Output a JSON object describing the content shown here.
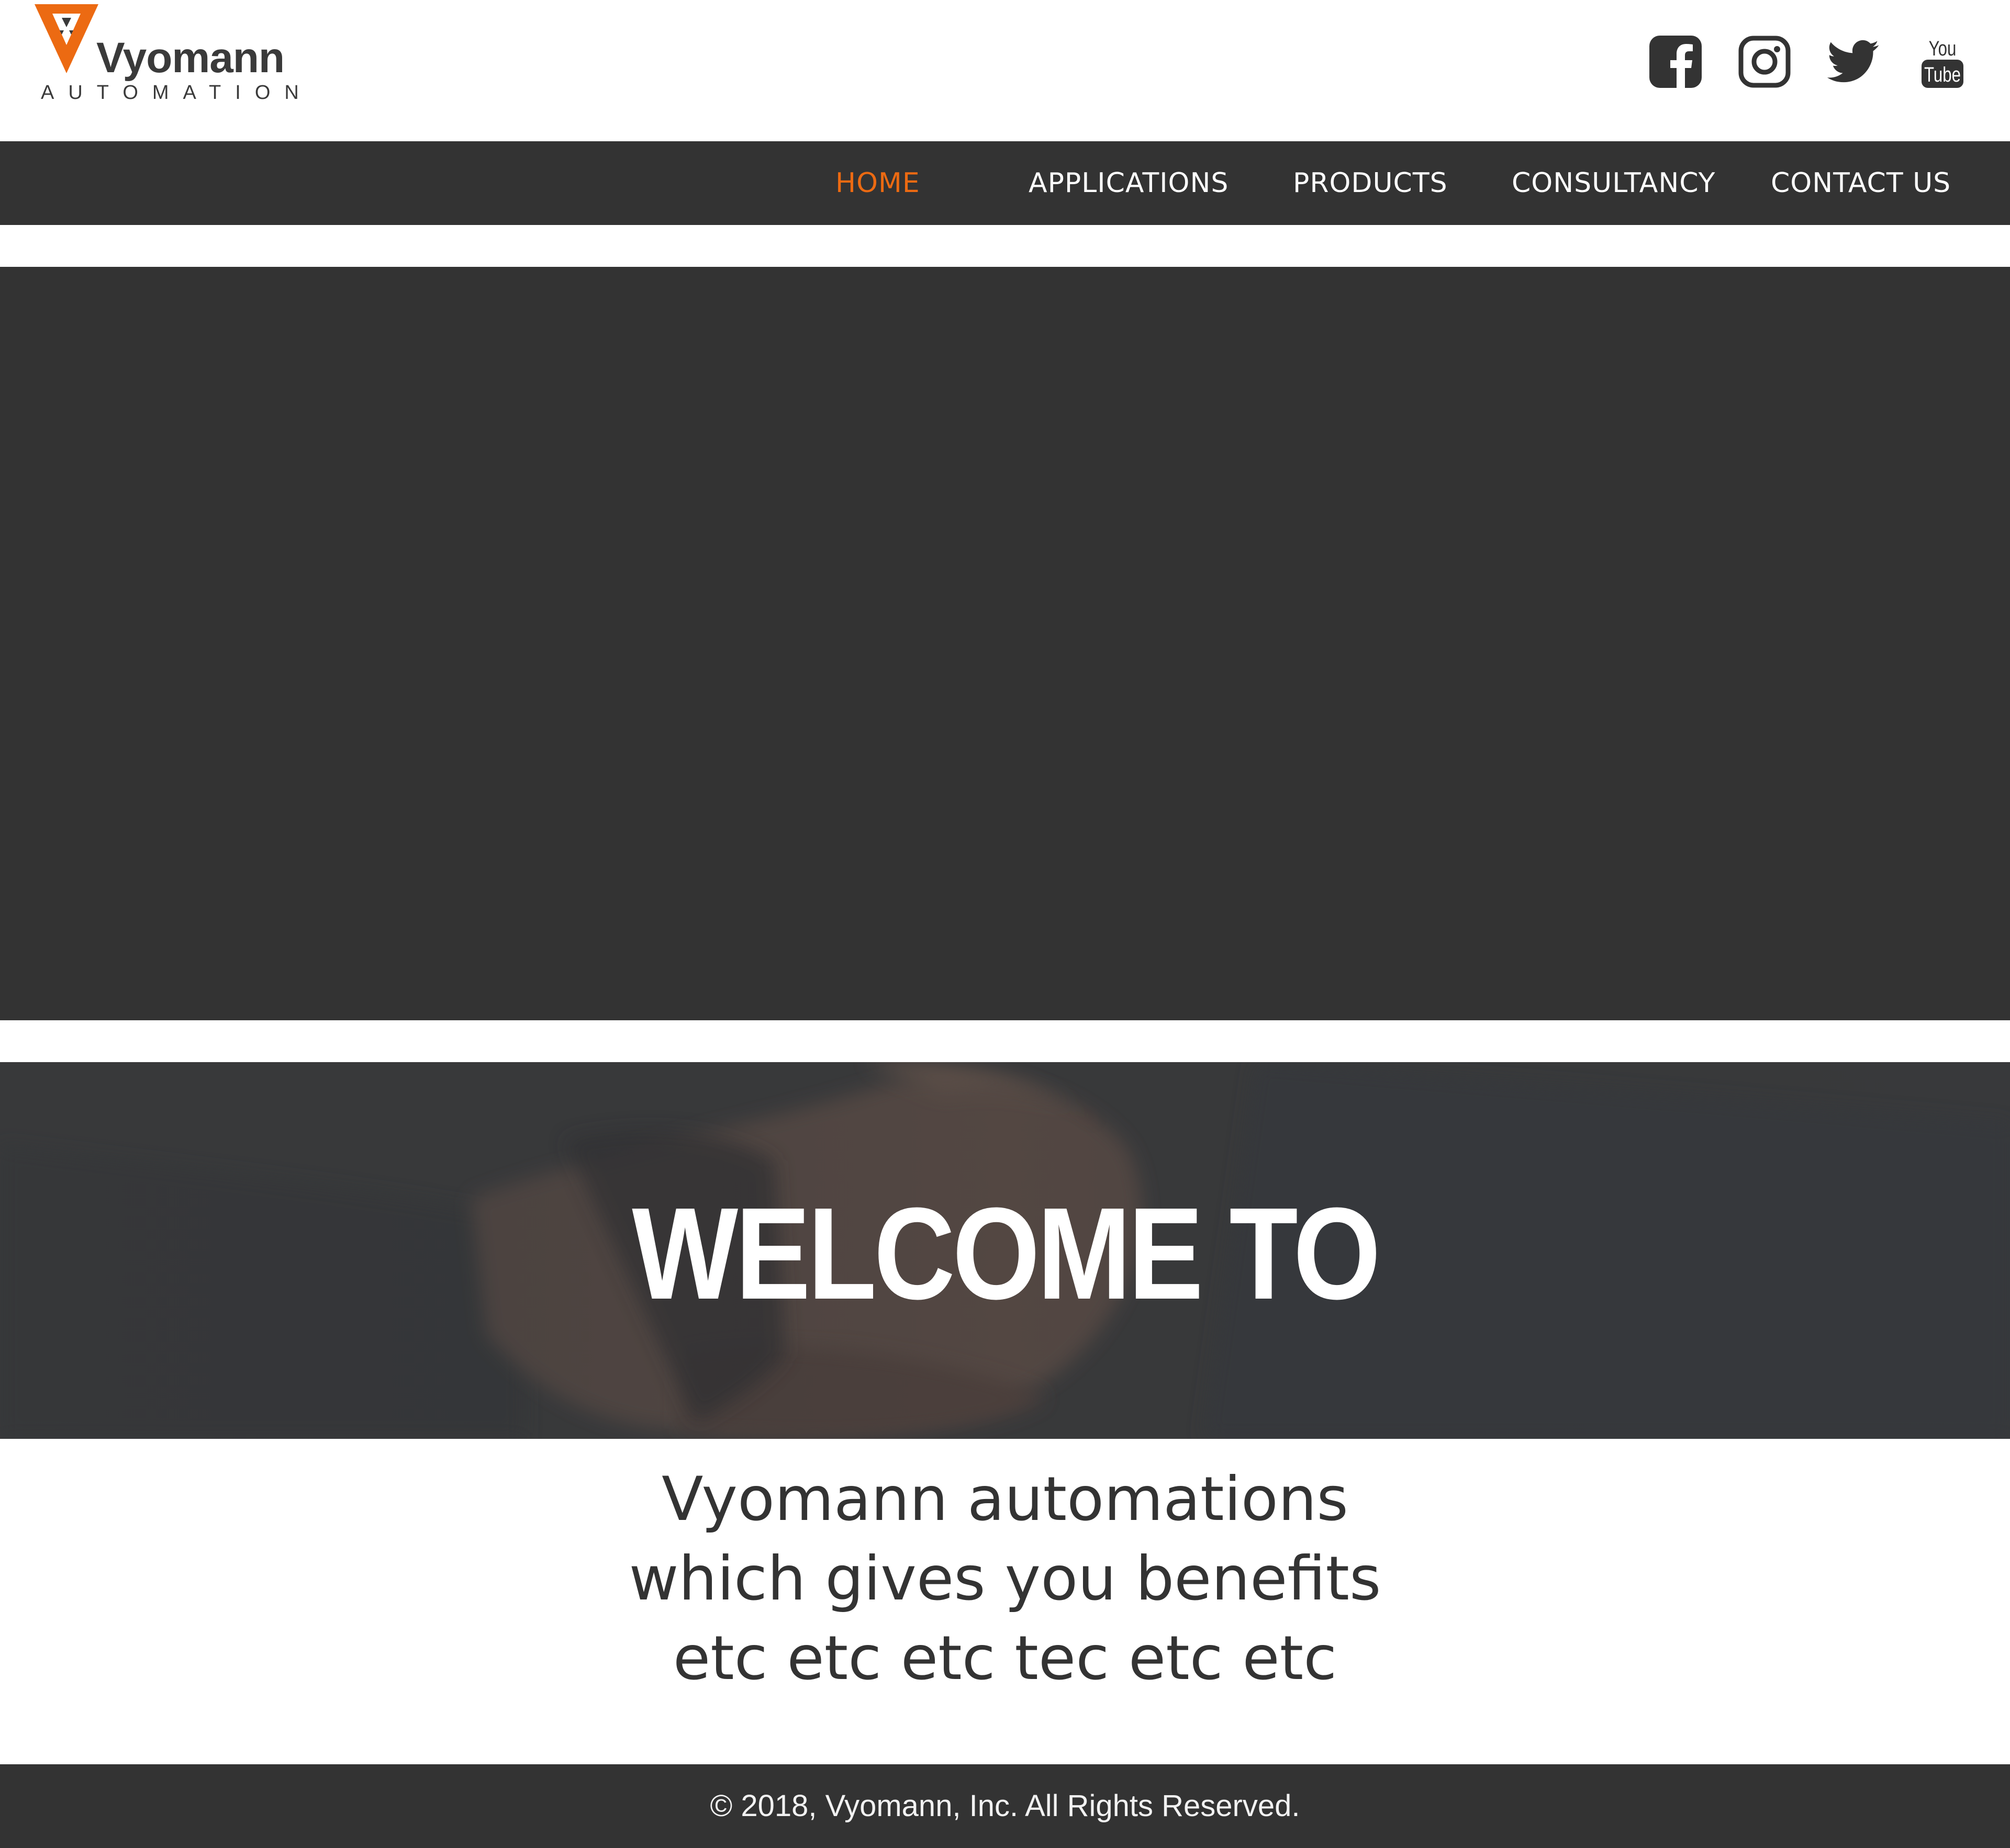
{
  "brand": {
    "name": "Vyomann",
    "tagline": "AUTOMATION",
    "accent_color": "#ec6a12"
  },
  "social": [
    {
      "name": "facebook",
      "icon": "facebook-icon"
    },
    {
      "name": "instagram",
      "icon": "instagram-icon"
    },
    {
      "name": "twitter",
      "icon": "twitter-icon"
    },
    {
      "name": "youtube",
      "icon": "youtube-icon",
      "label_top": "You",
      "label_bottom": "Tube"
    }
  ],
  "nav": {
    "items": [
      {
        "label": "HOME",
        "active": true
      },
      {
        "label": "APPLICATIONS",
        "active": false
      },
      {
        "label": "PRODUCTS",
        "active": false
      },
      {
        "label": "CONSULTANCY",
        "active": false
      },
      {
        "label": "CONTACT US",
        "active": false
      }
    ]
  },
  "hero": {
    "title": "WELCOME TO"
  },
  "intro": {
    "lines": [
      "Vyomann automations",
      "which gives you benefits",
      "etc etc etc tec etc etc"
    ]
  },
  "footer": {
    "copyright": "© 2018, Vyomann, Inc. All Rights Reserved."
  },
  "colors": {
    "dark": "#333333",
    "white": "#ffffff"
  }
}
